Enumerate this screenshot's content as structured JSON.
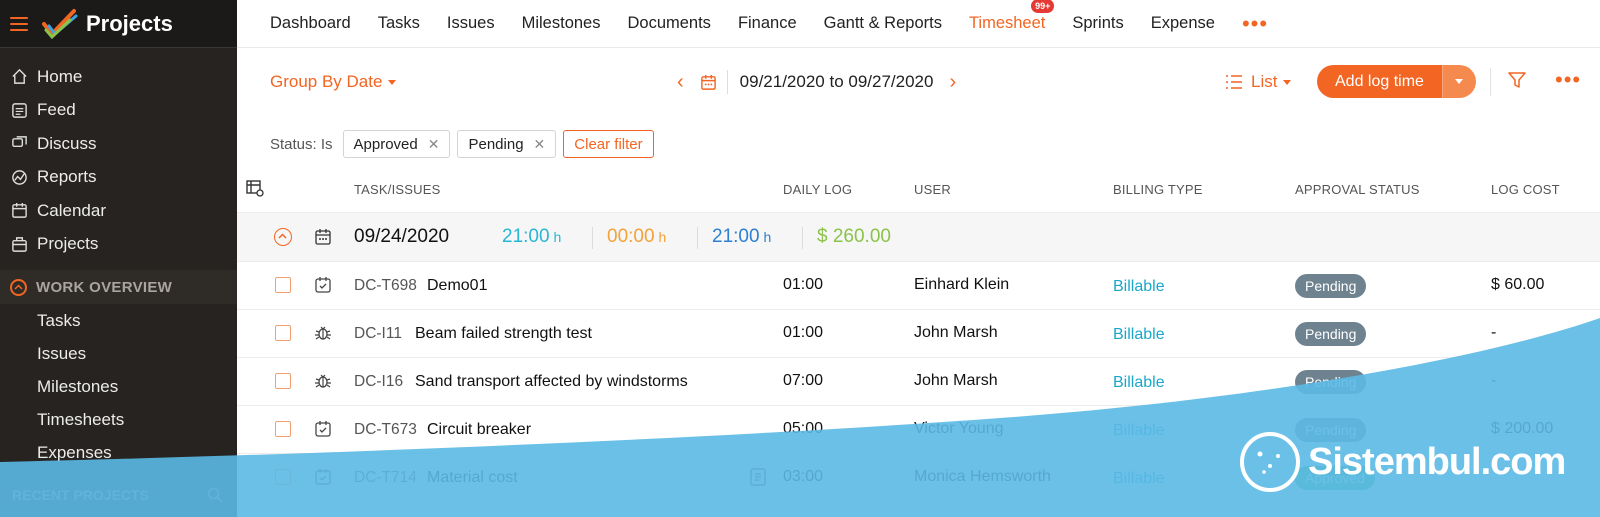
{
  "app": {
    "title": "Projects"
  },
  "sidebar": {
    "items": [
      {
        "label": "Home",
        "icon": "home-icon"
      },
      {
        "label": "Feed",
        "icon": "feed-icon"
      },
      {
        "label": "Discuss",
        "icon": "discuss-icon"
      },
      {
        "label": "Reports",
        "icon": "reports-icon"
      },
      {
        "label": "Calendar",
        "icon": "calendar-icon"
      },
      {
        "label": "Projects",
        "icon": "briefcase-icon"
      }
    ],
    "section": "WORK OVERVIEW",
    "sub_items": [
      "Tasks",
      "Issues",
      "Milestones",
      "Timesheets",
      "Expenses"
    ],
    "recent": "RECENT PROJECTS"
  },
  "topnav": {
    "tabs": [
      "Dashboard",
      "Tasks",
      "Issues",
      "Milestones",
      "Documents",
      "Finance",
      "Gantt & Reports",
      "Timesheet",
      "Sprints",
      "Expense"
    ],
    "active": "Timesheet",
    "badge": "99+",
    "more": "•••"
  },
  "toolbar": {
    "group_by": "Group By Date",
    "date_range": "09/21/2020 to 09/27/2020",
    "view": "List",
    "add_label": "Add log time",
    "more": "•••"
  },
  "filters": {
    "label": "Status: Is",
    "chips": [
      "Approved",
      "Pending"
    ],
    "clear": "Clear filter"
  },
  "table": {
    "headers": [
      "TASK/ISSUES",
      "DAILY LOG",
      "USER",
      "BILLING TYPE",
      "APPROVAL STATUS",
      "LOG COST"
    ],
    "group": {
      "date": "09/24/2020",
      "total": "21:00",
      "non_billable": "00:00",
      "billable": "21:00",
      "unit": "h",
      "cost": "$ 260.00"
    },
    "rows": [
      {
        "type": "task",
        "id": "DC-T698",
        "title": "Demo01",
        "daily": "01:00",
        "user": "Einhard Klein",
        "billing": "Billable",
        "status": "Pending",
        "cost": "$ 60.00"
      },
      {
        "type": "issue",
        "id": "DC-I11",
        "title": "Beam failed strength test",
        "daily": "01:00",
        "user": "John Marsh",
        "billing": "Billable",
        "status": "Pending",
        "cost": "-"
      },
      {
        "type": "issue",
        "id": "DC-I16",
        "title": "Sand transport affected by windstorms",
        "daily": "07:00",
        "user": "John Marsh",
        "billing": "Billable",
        "status": "Pending",
        "cost": "-"
      },
      {
        "type": "task",
        "id": "DC-T673",
        "title": "Circuit breaker",
        "daily": "05:00",
        "user": "Victor Young",
        "billing": "Billable",
        "status": "Pending",
        "cost": "$ 200.00"
      },
      {
        "type": "task",
        "id": "DC-T714",
        "title": "Material cost",
        "daily": "03:00",
        "user": "Monica Hemsworth",
        "billing": "Billable",
        "status": "Approved",
        "cost": ""
      }
    ]
  },
  "watermark": {
    "text": "Sistembul.com"
  },
  "colors": {
    "accent": "#f26522",
    "sidebar": "#262320",
    "billable": "#1aa7c9",
    "pending": "#6e8290",
    "approved": "#48c27a",
    "cost_total": "#8bc34a",
    "wave": "#5bb9e6"
  }
}
